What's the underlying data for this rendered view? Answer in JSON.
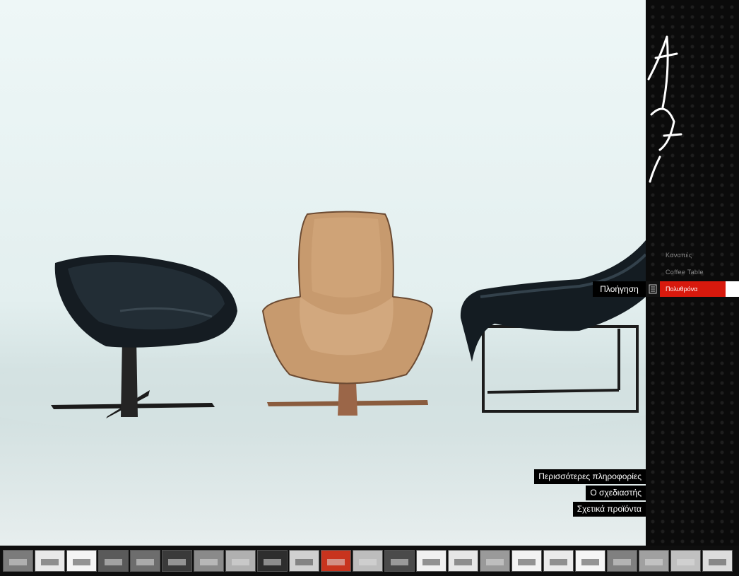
{
  "sidebar": {
    "menu": [
      {
        "label": "Καναπές"
      },
      {
        "label": "Coffee Table"
      },
      {
        "label": "Πολυθρόνα",
        "active": true
      }
    ],
    "nav_label": "Πλοήγηση"
  },
  "info_links": [
    {
      "label": "Περισσότερες πληροφορίες"
    },
    {
      "label": "Ο σχεδιαστής"
    },
    {
      "label": "Σχετικά προϊόντα"
    }
  ],
  "thumbnails": [
    {
      "tone": "#7b7b7b",
      "icon": "room-thumb"
    },
    {
      "tone": "#e8e8e8",
      "icon": "lounger-thumb"
    },
    {
      "tone": "#f4f4f4",
      "icon": "lounger-thumb"
    },
    {
      "tone": "#5a5a5a",
      "icon": "sofa-thumb"
    },
    {
      "tone": "#6d6d6d",
      "icon": "sofa-thumb"
    },
    {
      "tone": "#3a3a3a",
      "icon": "room-thumb"
    },
    {
      "tone": "#8a8a8a",
      "icon": "table-thumb"
    },
    {
      "tone": "#b0b0b0",
      "icon": "landscape-thumb"
    },
    {
      "tone": "#2e2e2e",
      "icon": "chairs-thumb"
    },
    {
      "tone": "#d0d0d0",
      "icon": "chair-thumb"
    },
    {
      "tone": "#c8341e",
      "icon": "red-armchair-thumb"
    },
    {
      "tone": "#bdbdbd",
      "icon": "armchair-thumb"
    },
    {
      "tone": "#4a4a4a",
      "icon": "chairs-thumb"
    },
    {
      "tone": "#f0f0f0",
      "icon": "chaise-thumb"
    },
    {
      "tone": "#e6e6e6",
      "icon": "chaise-thumb"
    },
    {
      "tone": "#9a9a9a",
      "icon": "cabinet-thumb"
    },
    {
      "tone": "#f2f2f2",
      "icon": "lounger-thumb"
    },
    {
      "tone": "#eaeaea",
      "icon": "sofa-thumb"
    },
    {
      "tone": "#f5f5f5",
      "icon": "chaise-thumb"
    },
    {
      "tone": "#808080",
      "icon": "landscape-thumb"
    },
    {
      "tone": "#a0a0a0",
      "icon": "landscape-thumb"
    },
    {
      "tone": "#c0c0c0",
      "icon": "chair-thumb"
    },
    {
      "tone": "#dcdcdc",
      "icon": "room-thumb"
    }
  ],
  "colors": {
    "accent": "#d8190d",
    "panel": "#0b0b0b"
  }
}
